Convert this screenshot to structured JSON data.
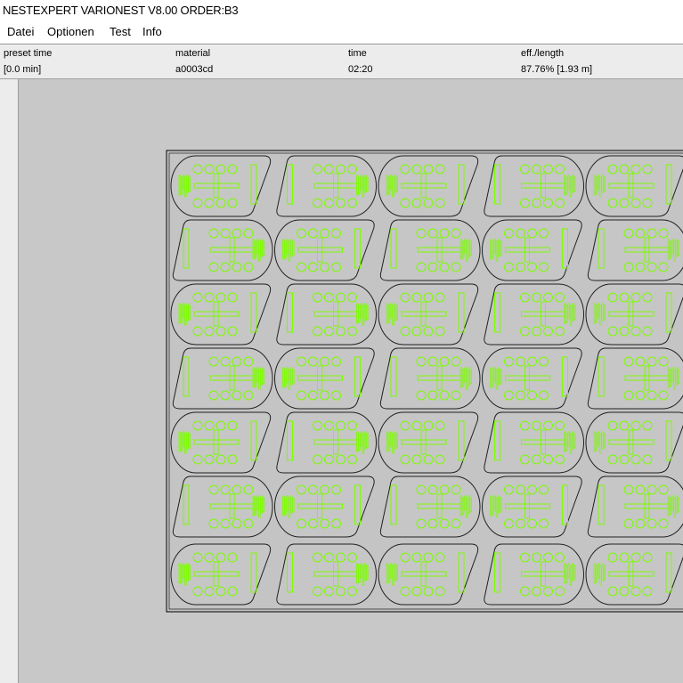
{
  "window": {
    "title": "NESTEXPERT VARIONEST V8.00 ORDER:B3"
  },
  "menu": {
    "items": [
      {
        "label": "Datei"
      },
      {
        "label": "Optionen"
      },
      {
        "label": "Test"
      },
      {
        "label": "Info"
      }
    ]
  },
  "status": {
    "columns": [
      {
        "header": "preset time",
        "value": "[0.0 min]"
      },
      {
        "header": "material",
        "value": "a0003cd"
      },
      {
        "header": "time",
        "value": "02:20"
      },
      {
        "header": "eff./length",
        "value": "87.76% [1.93 m]"
      }
    ]
  },
  "nest": {
    "rows": 7,
    "colors": {
      "canvas": "#c8c8c8",
      "sheet": "#c4c4c4",
      "part_outline": "#202020",
      "cut_contours": "#7cfc00"
    }
  }
}
